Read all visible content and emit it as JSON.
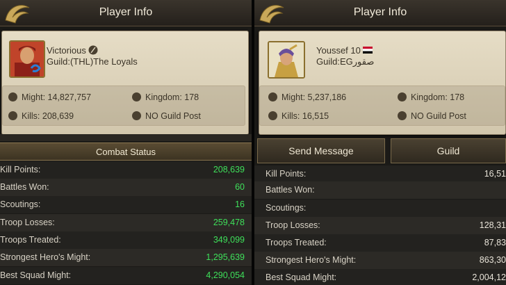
{
  "left": {
    "title": "Player Info",
    "player_name": "Victorious",
    "guild": "Guild:(THL)The Loyals",
    "might": "Might: 14,827,757",
    "kingdom": "Kingdom: 178",
    "kills": "Kills: 208,639",
    "guild_post": "NO Guild Post",
    "combat_tab": "Combat Status",
    "rows": [
      {
        "label": "Kill Points:",
        "value": "208,639"
      },
      {
        "label": "Battles Won:",
        "value": "60"
      },
      {
        "label": "Scoutings:",
        "value": "16"
      },
      {
        "label": "Troop Losses:",
        "value": "259,478"
      },
      {
        "label": "Troops Treated:",
        "value": "349,099"
      },
      {
        "label": "Strongest Hero's Might:",
        "value": "1,295,639"
      },
      {
        "label": "Best Squad Might:",
        "value": "4,290,054"
      }
    ]
  },
  "right": {
    "title": "Player Info",
    "player_name": "Youssef 10",
    "guild": "Guild:EGصقور",
    "might": "Might: 5,237,186",
    "kingdom": "Kingdom: 178",
    "kills": "Kills: 16,515",
    "guild_post": "NO Guild Post",
    "send_message": "Send Message",
    "guild_button": "Guild",
    "rows": [
      {
        "label": "Kill Points:",
        "value": "16,51"
      },
      {
        "label": "Battles Won:",
        "value": ""
      },
      {
        "label": "Scoutings:",
        "value": ""
      },
      {
        "label": "Troop Losses:",
        "value": "128,31"
      },
      {
        "label": "Troops Treated:",
        "value": "87,83"
      },
      {
        "label": "Strongest Hero's Might:",
        "value": "863,30"
      },
      {
        "label": "Best Squad Might:",
        "value": "2,004,12"
      }
    ]
  },
  "colors": {
    "value_green": "#3ee05a",
    "card_bg": "#e0d6bd",
    "header_gold": "#8a7550"
  },
  "icons": {
    "logo": "gold-dragon-emblem",
    "might": "crossed-swords-icon",
    "kingdom": "helmet-icon",
    "kills": "skull-icon",
    "guild_post": "crown-icon",
    "rename": "feather-icon",
    "flag": "flag-icon"
  }
}
